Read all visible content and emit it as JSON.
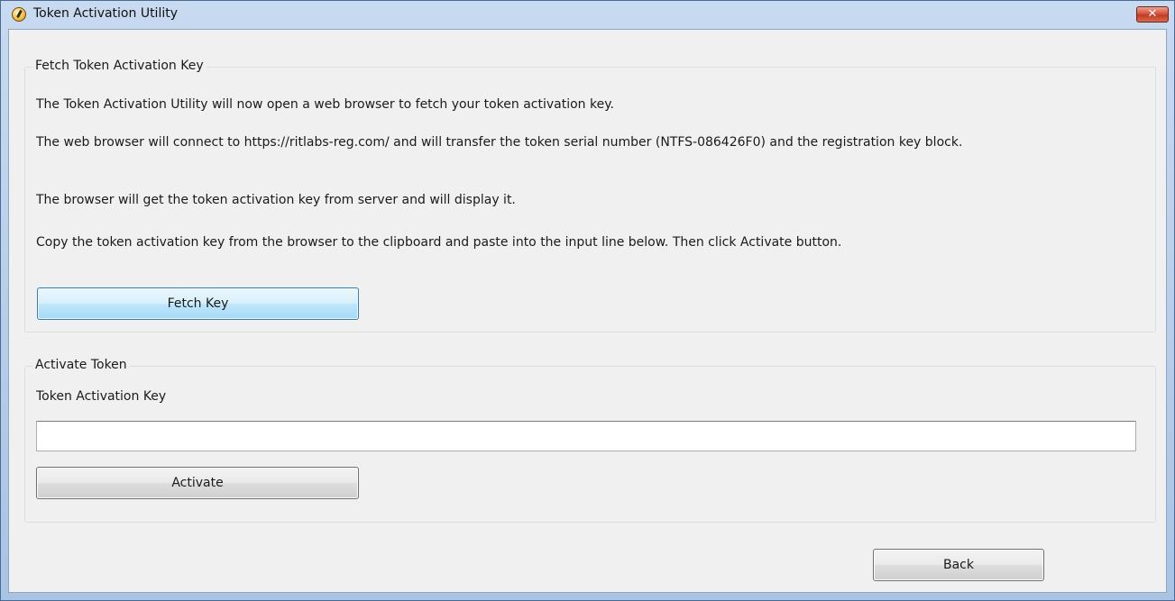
{
  "window": {
    "title": "Token Activation Utility",
    "close_label": "✕"
  },
  "fetch_group": {
    "legend": "Fetch Token Activation Key",
    "paragraphs": [
      "The Token Activation Utility will now open a web browser to fetch your token activation key.",
      "The web browser will connect to https://ritlabs-reg.com/ and will transfer the token serial number (NTFS-086426F0) and the registration key block.",
      "The browser will get the token activation key from server and will display it.",
      "Copy the token activation key from the browser to the clipboard and paste into the input line below. Then click Activate button."
    ],
    "fetch_button": "Fetch Key"
  },
  "activate_group": {
    "legend": "Activate Token",
    "key_label": "Token Activation Key",
    "key_value": "",
    "key_placeholder": "",
    "activate_button": "Activate"
  },
  "footer": {
    "back_button": "Back"
  }
}
